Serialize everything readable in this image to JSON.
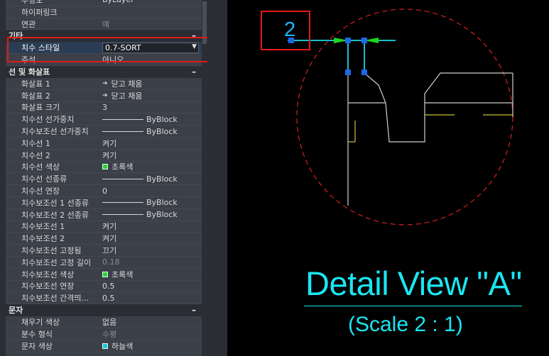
{
  "palette": {
    "top_rows": [
      {
        "name": "투명도",
        "value": "ByLayer",
        "dim": false
      },
      {
        "name": "하이퍼링크",
        "value": "",
        "dim": false
      },
      {
        "name": "연관",
        "value": "예",
        "dim": true
      }
    ],
    "misc_section": {
      "title": "기타",
      "toggle": "–",
      "dim_style_label": "치수 스타일",
      "dim_style_value": "0.7-SORT",
      "annotative_label": "주석",
      "annotative_value": "아니오"
    },
    "lines_section": {
      "title": "선 및 화살표",
      "toggle": "–",
      "rows": [
        {
          "name": "화살표 1",
          "value": "닫고 채움",
          "kind": "arrow",
          "dim": false
        },
        {
          "name": "화살표 2",
          "value": "닫고 채움",
          "kind": "arrow",
          "dim": false
        },
        {
          "name": "화살표 크기",
          "value": "3",
          "kind": "text",
          "dim": false
        },
        {
          "name": "치수선 선가중치",
          "value": "ByBlock",
          "kind": "line",
          "dim": false
        },
        {
          "name": "치수보조선 선가중치",
          "value": "ByBlock",
          "kind": "line",
          "dim": false
        },
        {
          "name": "치수선 1",
          "value": "켜기",
          "kind": "text",
          "dim": false
        },
        {
          "name": "치수선 2",
          "value": "켜기",
          "kind": "text",
          "dim": false
        },
        {
          "name": "치수선 색상",
          "value": "초록색",
          "kind": "green",
          "dim": false
        },
        {
          "name": "치수선 선종류",
          "value": "ByBlock",
          "kind": "line",
          "dim": false
        },
        {
          "name": "치수선 연장",
          "value": "0",
          "kind": "text",
          "dim": false
        },
        {
          "name": "치수보조선 1 선종류",
          "value": "ByBlock",
          "kind": "line",
          "dim": false
        },
        {
          "name": "치수보조선 2 선종류",
          "value": "ByBlock",
          "kind": "line",
          "dim": false
        },
        {
          "name": "치수보조선 1",
          "value": "켜기",
          "kind": "text",
          "dim": false
        },
        {
          "name": "치수보조선 2",
          "value": "켜기",
          "kind": "text",
          "dim": false
        },
        {
          "name": "치수보조선 고정됨",
          "value": "끄기",
          "kind": "text",
          "dim": false
        },
        {
          "name": "치수보조선 고정 길이",
          "value": "0.18",
          "kind": "text",
          "dim": true
        },
        {
          "name": "치수보조선 색상",
          "value": "초록색",
          "kind": "green",
          "dim": false
        },
        {
          "name": "치수보조선 연장",
          "value": "0.5",
          "kind": "text",
          "dim": false
        },
        {
          "name": "치수보조선 간격띄...",
          "value": "0.5",
          "kind": "text",
          "dim": false
        }
      ]
    },
    "text_section": {
      "title": "문자",
      "toggle": "–",
      "rows": [
        {
          "name": "채우기 색상",
          "value": "없음",
          "kind": "text",
          "dim": false
        },
        {
          "name": "분수 형식",
          "value": "수평",
          "kind": "text",
          "dim": true
        },
        {
          "name": "문자 색상",
          "value": "하늘색",
          "kind": "cyan",
          "dim": false
        }
      ]
    }
  },
  "drawing": {
    "dimension_text": "2",
    "detail_title": "Detail View \"A\"",
    "detail_scale": "(Scale 2 : 1)"
  },
  "colors": {
    "detail_text": "#19e6f2",
    "dimension": "#19b7ff",
    "highlight": "#e21b1b",
    "circle": "#d42020"
  }
}
